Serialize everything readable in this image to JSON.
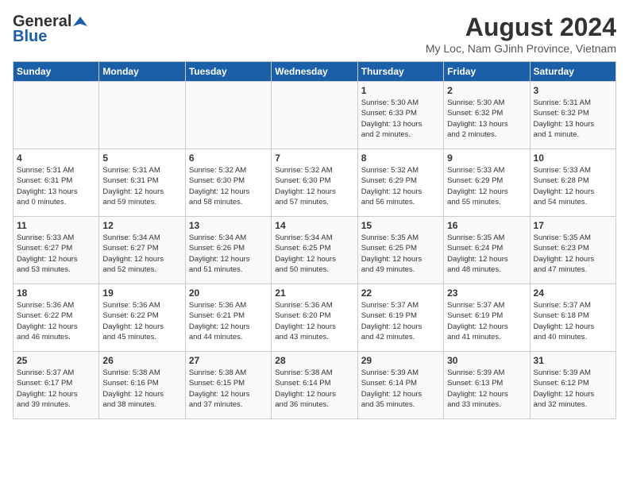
{
  "header": {
    "logo_general": "General",
    "logo_blue": "Blue",
    "month_title": "August 2024",
    "location": "My Loc, Nam GJinh Province, Vietnam"
  },
  "days_of_week": [
    "Sunday",
    "Monday",
    "Tuesday",
    "Wednesday",
    "Thursday",
    "Friday",
    "Saturday"
  ],
  "weeks": [
    [
      {
        "day": "",
        "info": ""
      },
      {
        "day": "",
        "info": ""
      },
      {
        "day": "",
        "info": ""
      },
      {
        "day": "",
        "info": ""
      },
      {
        "day": "1",
        "info": "Sunrise: 5:30 AM\nSunset: 6:33 PM\nDaylight: 13 hours\nand 2 minutes."
      },
      {
        "day": "2",
        "info": "Sunrise: 5:30 AM\nSunset: 6:32 PM\nDaylight: 13 hours\nand 2 minutes."
      },
      {
        "day": "3",
        "info": "Sunrise: 5:31 AM\nSunset: 6:32 PM\nDaylight: 13 hours\nand 1 minute."
      }
    ],
    [
      {
        "day": "4",
        "info": "Sunrise: 5:31 AM\nSunset: 6:31 PM\nDaylight: 13 hours\nand 0 minutes."
      },
      {
        "day": "5",
        "info": "Sunrise: 5:31 AM\nSunset: 6:31 PM\nDaylight: 12 hours\nand 59 minutes."
      },
      {
        "day": "6",
        "info": "Sunrise: 5:32 AM\nSunset: 6:30 PM\nDaylight: 12 hours\nand 58 minutes."
      },
      {
        "day": "7",
        "info": "Sunrise: 5:32 AM\nSunset: 6:30 PM\nDaylight: 12 hours\nand 57 minutes."
      },
      {
        "day": "8",
        "info": "Sunrise: 5:32 AM\nSunset: 6:29 PM\nDaylight: 12 hours\nand 56 minutes."
      },
      {
        "day": "9",
        "info": "Sunrise: 5:33 AM\nSunset: 6:29 PM\nDaylight: 12 hours\nand 55 minutes."
      },
      {
        "day": "10",
        "info": "Sunrise: 5:33 AM\nSunset: 6:28 PM\nDaylight: 12 hours\nand 54 minutes."
      }
    ],
    [
      {
        "day": "11",
        "info": "Sunrise: 5:33 AM\nSunset: 6:27 PM\nDaylight: 12 hours\nand 53 minutes."
      },
      {
        "day": "12",
        "info": "Sunrise: 5:34 AM\nSunset: 6:27 PM\nDaylight: 12 hours\nand 52 minutes."
      },
      {
        "day": "13",
        "info": "Sunrise: 5:34 AM\nSunset: 6:26 PM\nDaylight: 12 hours\nand 51 minutes."
      },
      {
        "day": "14",
        "info": "Sunrise: 5:34 AM\nSunset: 6:25 PM\nDaylight: 12 hours\nand 50 minutes."
      },
      {
        "day": "15",
        "info": "Sunrise: 5:35 AM\nSunset: 6:25 PM\nDaylight: 12 hours\nand 49 minutes."
      },
      {
        "day": "16",
        "info": "Sunrise: 5:35 AM\nSunset: 6:24 PM\nDaylight: 12 hours\nand 48 minutes."
      },
      {
        "day": "17",
        "info": "Sunrise: 5:35 AM\nSunset: 6:23 PM\nDaylight: 12 hours\nand 47 minutes."
      }
    ],
    [
      {
        "day": "18",
        "info": "Sunrise: 5:36 AM\nSunset: 6:22 PM\nDaylight: 12 hours\nand 46 minutes."
      },
      {
        "day": "19",
        "info": "Sunrise: 5:36 AM\nSunset: 6:22 PM\nDaylight: 12 hours\nand 45 minutes."
      },
      {
        "day": "20",
        "info": "Sunrise: 5:36 AM\nSunset: 6:21 PM\nDaylight: 12 hours\nand 44 minutes."
      },
      {
        "day": "21",
        "info": "Sunrise: 5:36 AM\nSunset: 6:20 PM\nDaylight: 12 hours\nand 43 minutes."
      },
      {
        "day": "22",
        "info": "Sunrise: 5:37 AM\nSunset: 6:19 PM\nDaylight: 12 hours\nand 42 minutes."
      },
      {
        "day": "23",
        "info": "Sunrise: 5:37 AM\nSunset: 6:19 PM\nDaylight: 12 hours\nand 41 minutes."
      },
      {
        "day": "24",
        "info": "Sunrise: 5:37 AM\nSunset: 6:18 PM\nDaylight: 12 hours\nand 40 minutes."
      }
    ],
    [
      {
        "day": "25",
        "info": "Sunrise: 5:37 AM\nSunset: 6:17 PM\nDaylight: 12 hours\nand 39 minutes."
      },
      {
        "day": "26",
        "info": "Sunrise: 5:38 AM\nSunset: 6:16 PM\nDaylight: 12 hours\nand 38 minutes."
      },
      {
        "day": "27",
        "info": "Sunrise: 5:38 AM\nSunset: 6:15 PM\nDaylight: 12 hours\nand 37 minutes."
      },
      {
        "day": "28",
        "info": "Sunrise: 5:38 AM\nSunset: 6:14 PM\nDaylight: 12 hours\nand 36 minutes."
      },
      {
        "day": "29",
        "info": "Sunrise: 5:39 AM\nSunset: 6:14 PM\nDaylight: 12 hours\nand 35 minutes."
      },
      {
        "day": "30",
        "info": "Sunrise: 5:39 AM\nSunset: 6:13 PM\nDaylight: 12 hours\nand 33 minutes."
      },
      {
        "day": "31",
        "info": "Sunrise: 5:39 AM\nSunset: 6:12 PM\nDaylight: 12 hours\nand 32 minutes."
      }
    ]
  ]
}
